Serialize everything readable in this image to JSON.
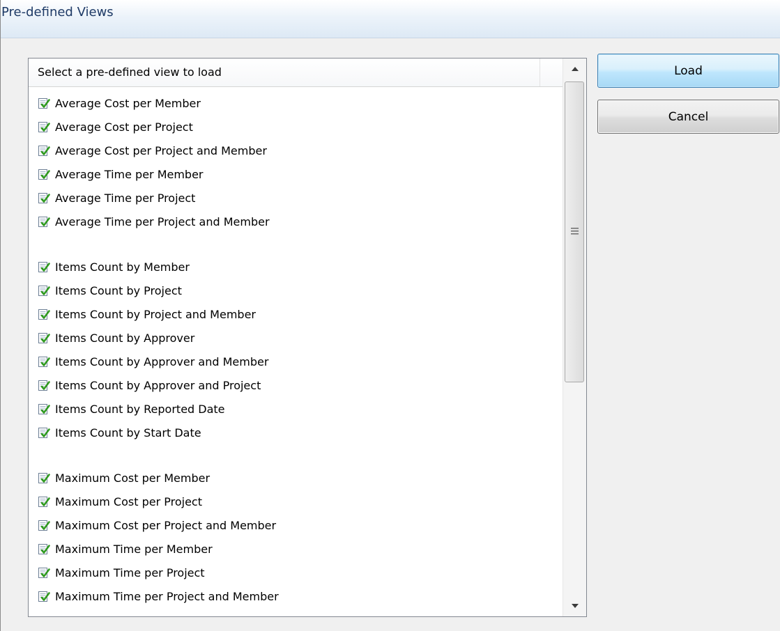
{
  "window": {
    "title": "Pre-defined Views"
  },
  "list": {
    "header": "Select a pre-defined view to load",
    "groups": [
      {
        "items": [
          "Average Cost per Member",
          "Average Cost per Project",
          "Average Cost per Project and Member",
          "Average Time per Member",
          "Average Time per Project",
          "Average Time per Project and Member"
        ]
      },
      {
        "items": [
          "Items Count by Member",
          "Items Count by Project",
          "Items Count by Project and Member",
          "Items Count by Approver",
          "Items Count by Approver and Member",
          "Items Count by Approver and Project",
          "Items Count by Reported Date",
          "Items Count by Start Date"
        ]
      },
      {
        "items": [
          "Maximum Cost per Member",
          "Maximum Cost per Project",
          "Maximum Cost per Project and Member",
          "Maximum Time per Member",
          "Maximum Time per Project",
          "Maximum Time per Project and Member"
        ]
      }
    ],
    "item_icon": "document-check-icon"
  },
  "buttons": {
    "load_label": "Load",
    "cancel_label": "Cancel"
  },
  "colors": {
    "title_text": "#1e3a66",
    "load_border": "#3c7fb1",
    "list_border": "#828790",
    "window_bg": "#f0f0f0"
  }
}
